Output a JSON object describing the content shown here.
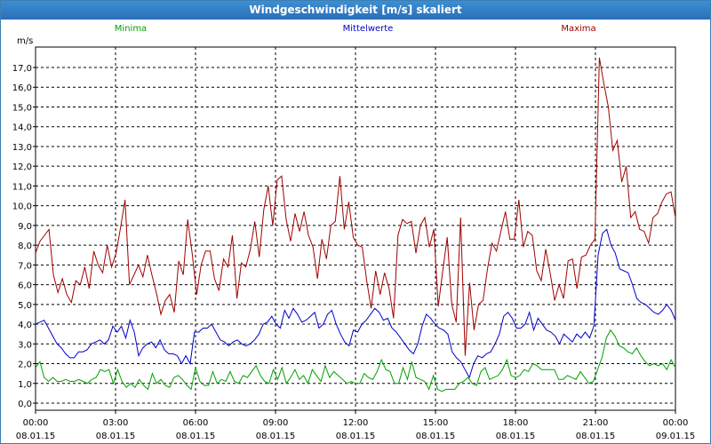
{
  "window": {
    "title": "Windgeschwindigkeit [m/s] skaliert"
  },
  "chart_data": {
    "type": "line",
    "title": "Windgeschwindigkeit [m/s] skaliert",
    "ylabel": "m/s",
    "xlabel": "",
    "ylim": [
      0,
      18
    ],
    "xlim": [
      0,
      24
    ],
    "y_ticks": [
      "0,0",
      "1,0",
      "2,0",
      "3,0",
      "4,0",
      "5,0",
      "6,0",
      "7,0",
      "8,0",
      "9,0",
      "10,0",
      "11,0",
      "12,0",
      "13,0",
      "14,0",
      "15,0",
      "16,0",
      "17,0"
    ],
    "x_ticks": [
      {
        "time": "00:00",
        "date": "08.01.15"
      },
      {
        "time": "03:00",
        "date": "08.01.15"
      },
      {
        "time": "06:00",
        "date": "08.01.15"
      },
      {
        "time": "09:00",
        "date": "08.01.15"
      },
      {
        "time": "12:00",
        "date": "08.01.15"
      },
      {
        "time": "15:00",
        "date": "08.01.15"
      },
      {
        "time": "18:00",
        "date": "08.01.15"
      },
      {
        "time": "21:00",
        "date": "08.01.15"
      },
      {
        "time": "00:00",
        "date": "09.01.15"
      }
    ],
    "grid": true,
    "legend_placement": "top",
    "series": [
      {
        "name": "Minima",
        "color": "#00a000",
        "values": [
          1.8,
          2.1,
          1.3,
          1.1,
          1.3,
          1.1,
          1.1,
          1.2,
          1.1,
          1.1,
          1.2,
          1.1,
          1.0,
          1.2,
          1.3,
          1.7,
          1.6,
          1.7,
          1.0,
          1.7,
          1.1,
          0.8,
          1.0,
          0.8,
          1.2,
          0.9,
          0.7,
          1.5,
          1.0,
          1.2,
          0.9,
          0.8,
          1.3,
          1.4,
          1.2,
          0.9,
          0.7,
          1.8,
          1.1,
          0.9,
          0.9,
          1.6,
          1.0,
          1.2,
          1.1,
          1.6,
          1.1,
          1.0,
          1.4,
          1.3,
          1.6,
          1.9,
          1.4,
          1.1,
          1.0,
          1.7,
          1.2,
          1.8,
          1.0,
          1.3,
          1.7,
          1.2,
          1.4,
          1.0,
          1.7,
          1.4,
          1.1,
          1.9,
          1.3,
          1.6,
          1.4,
          1.2,
          1.0,
          1.1,
          1.0,
          1.0,
          1.5,
          1.3,
          1.2,
          1.6,
          2.2,
          1.7,
          1.6,
          1.0,
          1.0,
          1.8,
          1.2,
          2.1,
          1.3,
          1.2,
          1.1,
          0.7,
          1.4,
          0.7,
          0.6,
          0.7,
          0.7,
          0.7,
          1.0,
          1.1,
          1.3,
          1.0,
          0.9,
          1.6,
          1.8,
          1.2,
          1.3,
          1.4,
          1.7,
          2.2,
          1.4,
          1.3,
          1.4,
          1.7,
          1.6,
          2.0,
          1.9,
          1.7,
          1.7,
          1.7,
          1.7,
          1.2,
          1.2,
          1.4,
          1.3,
          1.2,
          1.6,
          1.3,
          1.0,
          1.1,
          1.7,
          2.3,
          3.3,
          3.7,
          3.4,
          2.9,
          2.8,
          2.6,
          2.5,
          2.8,
          2.4,
          2.1,
          1.9,
          2.0,
          1.9,
          2.0,
          1.7,
          2.2,
          1.8
        ]
      },
      {
        "name": "Mittelwerte",
        "color": "#0000cc",
        "values": [
          4.0,
          4.1,
          4.2,
          3.8,
          3.4,
          3.0,
          2.8,
          2.5,
          2.3,
          2.3,
          2.6,
          2.6,
          2.7,
          3.0,
          3.1,
          3.2,
          3.0,
          3.2,
          3.9,
          3.6,
          3.9,
          3.3,
          4.2,
          3.6,
          2.4,
          2.8,
          3.0,
          3.1,
          2.8,
          3.2,
          2.7,
          2.5,
          2.5,
          2.4,
          2.0,
          2.4,
          2.0,
          3.6,
          3.6,
          3.8,
          3.8,
          4.0,
          3.6,
          3.2,
          3.1,
          2.9,
          3.1,
          3.2,
          3.0,
          2.9,
          3.0,
          3.2,
          3.5,
          4.0,
          4.1,
          4.4,
          4.0,
          3.8,
          4.7,
          4.3,
          4.8,
          4.5,
          4.1,
          4.2,
          4.4,
          4.6,
          3.8,
          4.0,
          4.5,
          4.7,
          4.0,
          3.5,
          3.1,
          2.9,
          3.7,
          3.6,
          4.0,
          4.2,
          4.5,
          4.8,
          4.6,
          4.2,
          4.3,
          3.8,
          3.6,
          3.3,
          3.0,
          2.7,
          2.5,
          3.0,
          3.9,
          4.5,
          4.3,
          4.0,
          3.8,
          3.7,
          3.5,
          2.6,
          2.3,
          2.1,
          1.7,
          1.3,
          2.0,
          2.4,
          2.3,
          2.5,
          2.6,
          3.0,
          3.5,
          4.4,
          4.6,
          4.3,
          3.8,
          3.8,
          4.0,
          4.6,
          3.7,
          4.3,
          4.0,
          3.7,
          3.6,
          3.4,
          3.0,
          3.5,
          3.3,
          3.1,
          3.5,
          3.3,
          3.6,
          3.3,
          3.9,
          7.5,
          8.6,
          8.8,
          8.0,
          7.6,
          6.8,
          6.7,
          6.6,
          6.0,
          5.3,
          5.1,
          5.0,
          4.8,
          4.6,
          4.5,
          4.7,
          5.0,
          4.7,
          4.2
        ]
      },
      {
        "name": "Maxima",
        "color": "#a00000",
        "values": [
          7.6,
          8.2,
          8.5,
          8.8,
          6.5,
          5.6,
          6.3,
          5.5,
          5.1,
          6.2,
          6.0,
          6.9,
          5.8,
          7.7,
          7.0,
          6.6,
          8.0,
          6.9,
          7.6,
          8.9,
          10.3,
          6.0,
          6.5,
          7.0,
          6.4,
          7.5,
          6.5,
          5.6,
          4.5,
          5.2,
          5.5,
          4.6,
          7.2,
          6.5,
          9.3,
          7.6,
          5.5,
          7.0,
          7.7,
          7.7,
          6.3,
          5.7,
          7.3,
          6.9,
          8.5,
          5.3,
          7.1,
          6.9,
          7.8,
          9.2,
          7.4,
          9.8,
          11.0,
          9.0,
          11.3,
          11.5,
          9.3,
          8.2,
          9.6,
          8.7,
          9.7,
          8.5,
          7.9,
          6.3,
          8.3,
          7.3,
          9.0,
          9.2,
          11.5,
          8.8,
          10.2,
          8.4,
          8.0,
          7.9,
          6.2,
          4.8,
          6.7,
          5.5,
          6.6,
          5.8,
          4.3,
          8.5,
          9.3,
          9.1,
          9.2,
          7.6,
          9.0,
          9.4,
          7.9,
          8.8,
          4.9,
          6.7,
          8.4,
          5.0,
          4.1,
          9.4,
          2.4,
          6.1,
          3.7,
          5.0,
          5.2,
          6.8,
          8.1,
          7.7,
          8.7,
          9.7,
          8.3,
          8.3,
          10.3,
          7.9,
          8.7,
          8.5,
          6.7,
          6.2,
          7.8,
          6.6,
          5.2,
          6.0,
          5.3,
          7.2,
          7.3,
          5.8,
          7.4,
          7.5,
          8.0,
          8.3,
          17.5,
          16.2,
          15.0,
          12.8,
          13.3,
          11.2,
          12.0,
          9.4,
          9.7,
          8.8,
          8.7,
          8.1,
          9.4,
          9.6,
          10.2,
          10.6,
          10.7,
          9.4
        ]
      }
    ]
  }
}
